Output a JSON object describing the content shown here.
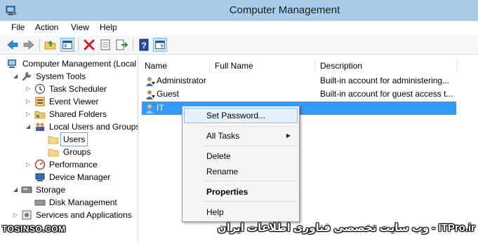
{
  "window": {
    "title": "Computer Management"
  },
  "menu": [
    "File",
    "Action",
    "View",
    "Help"
  ],
  "toolbar": {
    "buttons": [
      "back-icon",
      "forward-icon",
      "up-folder-icon",
      "show-hide-tree-icon",
      "delete-icon",
      "properties-icon",
      "export-list-icon",
      "help-icon",
      "show-action-pane-icon"
    ]
  },
  "tree": {
    "items": [
      {
        "label": "Computer Management (Local",
        "icon": "computer-management-icon"
      },
      {
        "label": "System Tools",
        "icon": "system-tools-icon"
      },
      {
        "label": "Task Scheduler",
        "icon": "clock-icon"
      },
      {
        "label": "Event Viewer",
        "icon": "event-viewer-icon"
      },
      {
        "label": "Shared Folders",
        "icon": "shared-folder-icon"
      },
      {
        "label": "Local Users and Groups",
        "icon": "users-group-icon"
      },
      {
        "label": "Users",
        "icon": "folder-icon"
      },
      {
        "label": "Groups",
        "icon": "folder-icon"
      },
      {
        "label": "Performance",
        "icon": "performance-icon"
      },
      {
        "label": "Device Manager",
        "icon": "device-manager-icon"
      },
      {
        "label": "Storage",
        "icon": "storage-icon"
      },
      {
        "label": "Disk Management",
        "icon": "disk-icon"
      },
      {
        "label": "Services and Applications",
        "icon": "services-icon"
      }
    ]
  },
  "list": {
    "columns": [
      "Name",
      "Full Name",
      "Description"
    ],
    "rows": [
      {
        "name": "Administrator",
        "full_name": "",
        "description": "Built-in account for administering..."
      },
      {
        "name": "Guest",
        "full_name": "",
        "description": "Built-in account for guest access t..."
      },
      {
        "name": "IT",
        "full_name": "",
        "description": ""
      }
    ]
  },
  "context_menu": {
    "items": [
      "Set Password...",
      "All Tasks",
      "Delete",
      "Rename",
      "Properties",
      "Help"
    ]
  },
  "watermark": {
    "left": "TOSINSO.COM",
    "right": "ITPro.ir - وب سایت تخصصی فناوری اطلاعات ایران"
  }
}
